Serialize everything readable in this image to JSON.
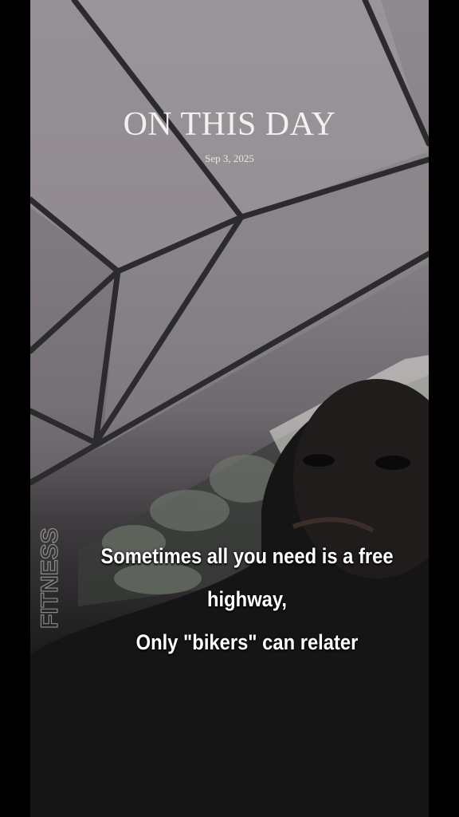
{
  "story": {
    "heading": "ON THIS DAY",
    "date": "Sep 3, 2025",
    "caption_lines": [
      "Sometimes all you need is a free",
      "highway,",
      "Only \"bikers\" can relater"
    ],
    "watermark": "FITNESS"
  },
  "colors": {
    "letterbox": "#000000",
    "text": "#ffffff"
  }
}
